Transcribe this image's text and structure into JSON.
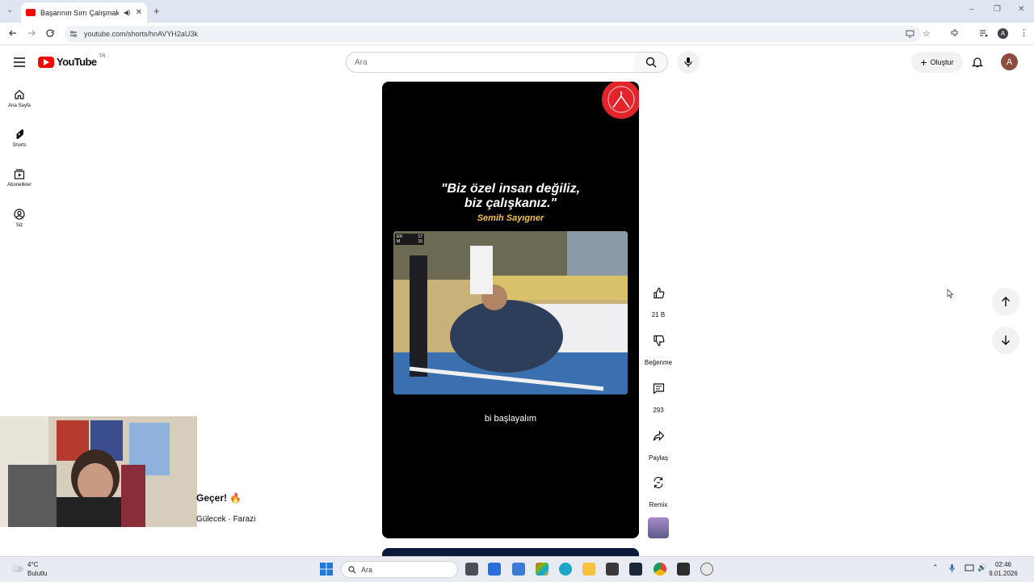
{
  "browser": {
    "tab_title": "Başarının Sırrı Çalışmaktan",
    "url": "youtube.com/shorts/hnAVYH2aU3k",
    "profile_initial": "A"
  },
  "masthead": {
    "logo_text": "YouTube",
    "region": "TR",
    "search_placeholder": "Ara",
    "create_label": "Oluştur",
    "avatar_initial": "A"
  },
  "sidebar": {
    "items": [
      {
        "label": "Ana Sayfa",
        "icon": "home-icon"
      },
      {
        "label": "Shorts",
        "icon": "shorts-icon"
      },
      {
        "label": "Abonelikler",
        "icon": "subscriptions-icon"
      },
      {
        "label": "Siz",
        "icon": "you-icon"
      }
    ]
  },
  "video": {
    "quote_line1": "\"Biz özel insan değiliz,",
    "quote_line2": "biz çalışkanız.\"",
    "author": "Semih Sayıgner",
    "brand": "bi başlayalım",
    "scoreboard": [
      {
        "code": "ER",
        "score": "17"
      },
      {
        "code": "M",
        "score": "15"
      }
    ]
  },
  "actions": {
    "like_count": "21 B",
    "dislike_label": "Beğenme",
    "comment_count": "293",
    "share_label": "Paylaş",
    "remix_label": "Remix"
  },
  "overlay": {
    "title": "Geçer! 🔥",
    "subtitle": "Gülecek · Farazi"
  },
  "taskbar": {
    "weather_temp": "4°C",
    "weather_desc": "Bulutlu",
    "search_placeholder": "Ara",
    "time": "02:46",
    "date": "9.01.2026"
  },
  "colors": {
    "youtube_red": "#ff0000",
    "quote_author": "#f5c04e",
    "video_bg": "#000000"
  }
}
